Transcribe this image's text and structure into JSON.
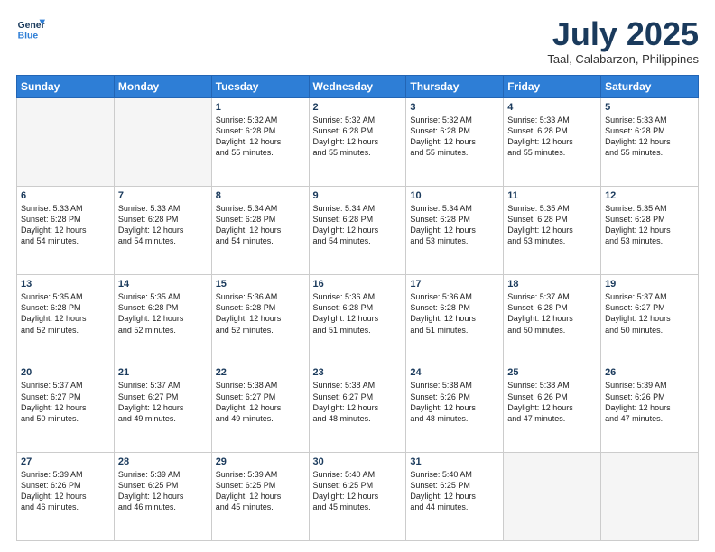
{
  "header": {
    "logo_line1": "General",
    "logo_line2": "Blue",
    "month_title": "July 2025",
    "location": "Taal, Calabarzon, Philippines"
  },
  "days_of_week": [
    "Sunday",
    "Monday",
    "Tuesday",
    "Wednesday",
    "Thursday",
    "Friday",
    "Saturday"
  ],
  "weeks": [
    [
      {
        "day": "",
        "text": ""
      },
      {
        "day": "",
        "text": ""
      },
      {
        "day": "1",
        "text": "Sunrise: 5:32 AM\nSunset: 6:28 PM\nDaylight: 12 hours\nand 55 minutes."
      },
      {
        "day": "2",
        "text": "Sunrise: 5:32 AM\nSunset: 6:28 PM\nDaylight: 12 hours\nand 55 minutes."
      },
      {
        "day": "3",
        "text": "Sunrise: 5:32 AM\nSunset: 6:28 PM\nDaylight: 12 hours\nand 55 minutes."
      },
      {
        "day": "4",
        "text": "Sunrise: 5:33 AM\nSunset: 6:28 PM\nDaylight: 12 hours\nand 55 minutes."
      },
      {
        "day": "5",
        "text": "Sunrise: 5:33 AM\nSunset: 6:28 PM\nDaylight: 12 hours\nand 55 minutes."
      }
    ],
    [
      {
        "day": "6",
        "text": "Sunrise: 5:33 AM\nSunset: 6:28 PM\nDaylight: 12 hours\nand 54 minutes."
      },
      {
        "day": "7",
        "text": "Sunrise: 5:33 AM\nSunset: 6:28 PM\nDaylight: 12 hours\nand 54 minutes."
      },
      {
        "day": "8",
        "text": "Sunrise: 5:34 AM\nSunset: 6:28 PM\nDaylight: 12 hours\nand 54 minutes."
      },
      {
        "day": "9",
        "text": "Sunrise: 5:34 AM\nSunset: 6:28 PM\nDaylight: 12 hours\nand 54 minutes."
      },
      {
        "day": "10",
        "text": "Sunrise: 5:34 AM\nSunset: 6:28 PM\nDaylight: 12 hours\nand 53 minutes."
      },
      {
        "day": "11",
        "text": "Sunrise: 5:35 AM\nSunset: 6:28 PM\nDaylight: 12 hours\nand 53 minutes."
      },
      {
        "day": "12",
        "text": "Sunrise: 5:35 AM\nSunset: 6:28 PM\nDaylight: 12 hours\nand 53 minutes."
      }
    ],
    [
      {
        "day": "13",
        "text": "Sunrise: 5:35 AM\nSunset: 6:28 PM\nDaylight: 12 hours\nand 52 minutes."
      },
      {
        "day": "14",
        "text": "Sunrise: 5:35 AM\nSunset: 6:28 PM\nDaylight: 12 hours\nand 52 minutes."
      },
      {
        "day": "15",
        "text": "Sunrise: 5:36 AM\nSunset: 6:28 PM\nDaylight: 12 hours\nand 52 minutes."
      },
      {
        "day": "16",
        "text": "Sunrise: 5:36 AM\nSunset: 6:28 PM\nDaylight: 12 hours\nand 51 minutes."
      },
      {
        "day": "17",
        "text": "Sunrise: 5:36 AM\nSunset: 6:28 PM\nDaylight: 12 hours\nand 51 minutes."
      },
      {
        "day": "18",
        "text": "Sunrise: 5:37 AM\nSunset: 6:28 PM\nDaylight: 12 hours\nand 50 minutes."
      },
      {
        "day": "19",
        "text": "Sunrise: 5:37 AM\nSunset: 6:27 PM\nDaylight: 12 hours\nand 50 minutes."
      }
    ],
    [
      {
        "day": "20",
        "text": "Sunrise: 5:37 AM\nSunset: 6:27 PM\nDaylight: 12 hours\nand 50 minutes."
      },
      {
        "day": "21",
        "text": "Sunrise: 5:37 AM\nSunset: 6:27 PM\nDaylight: 12 hours\nand 49 minutes."
      },
      {
        "day": "22",
        "text": "Sunrise: 5:38 AM\nSunset: 6:27 PM\nDaylight: 12 hours\nand 49 minutes."
      },
      {
        "day": "23",
        "text": "Sunrise: 5:38 AM\nSunset: 6:27 PM\nDaylight: 12 hours\nand 48 minutes."
      },
      {
        "day": "24",
        "text": "Sunrise: 5:38 AM\nSunset: 6:26 PM\nDaylight: 12 hours\nand 48 minutes."
      },
      {
        "day": "25",
        "text": "Sunrise: 5:38 AM\nSunset: 6:26 PM\nDaylight: 12 hours\nand 47 minutes."
      },
      {
        "day": "26",
        "text": "Sunrise: 5:39 AM\nSunset: 6:26 PM\nDaylight: 12 hours\nand 47 minutes."
      }
    ],
    [
      {
        "day": "27",
        "text": "Sunrise: 5:39 AM\nSunset: 6:26 PM\nDaylight: 12 hours\nand 46 minutes."
      },
      {
        "day": "28",
        "text": "Sunrise: 5:39 AM\nSunset: 6:25 PM\nDaylight: 12 hours\nand 46 minutes."
      },
      {
        "day": "29",
        "text": "Sunrise: 5:39 AM\nSunset: 6:25 PM\nDaylight: 12 hours\nand 45 minutes."
      },
      {
        "day": "30",
        "text": "Sunrise: 5:40 AM\nSunset: 6:25 PM\nDaylight: 12 hours\nand 45 minutes."
      },
      {
        "day": "31",
        "text": "Sunrise: 5:40 AM\nSunset: 6:25 PM\nDaylight: 12 hours\nand 44 minutes."
      },
      {
        "day": "",
        "text": ""
      },
      {
        "day": "",
        "text": ""
      }
    ]
  ]
}
